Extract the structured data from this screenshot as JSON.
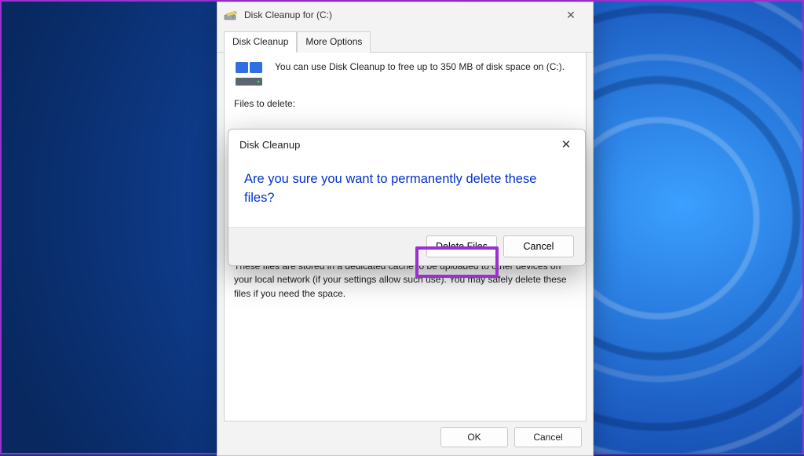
{
  "mainWindow": {
    "title": "Disk Cleanup for  (C:)",
    "tabs": {
      "cleanup": "Disk Cleanup",
      "moreOptions": "More Options"
    },
    "introText": "You can use Disk Cleanup to free up to 350 MB of disk space on (C:).",
    "filesToDeleteLabel": "Files to delete:",
    "descriptionText": "These files are stored in a dedicated cache to be uploaded to other devices on your local network (if your settings allow such use). You may safely delete these files if you need the space.",
    "okLabel": "OK",
    "cancelLabel": "Cancel"
  },
  "dialog": {
    "title": "Disk Cleanup",
    "question": "Are you sure you want to permanently delete these files?",
    "deleteLabel": "Delete Files",
    "cancelLabel": "Cancel"
  }
}
